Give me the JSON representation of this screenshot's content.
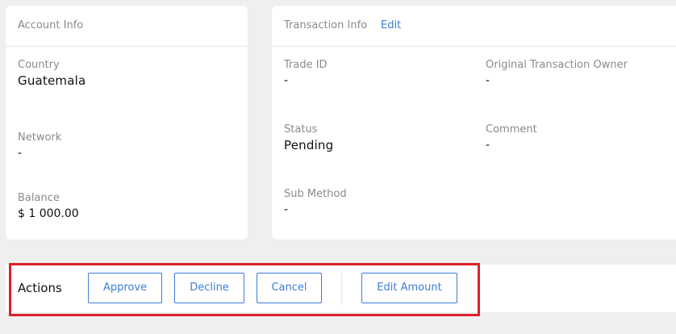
{
  "account_info": {
    "title": "Account Info",
    "fields": [
      {
        "label": "Country",
        "value": "Guatemala"
      },
      {
        "label": "Network",
        "value": "-"
      },
      {
        "label": "Balance",
        "value": "$ 1 000.00"
      }
    ]
  },
  "transaction_info": {
    "title": "Transaction Info",
    "edit_label": "Edit",
    "fields": [
      {
        "label": "Trade ID",
        "value": "-"
      },
      {
        "label": "Original Transaction Owner",
        "value": "-"
      },
      {
        "label": "Status",
        "value": "Pending"
      },
      {
        "label": "Comment",
        "value": "-"
      },
      {
        "label": "Sub Method",
        "value": "-"
      }
    ]
  },
  "actions": {
    "label": "Actions",
    "approve_label": "Approve",
    "decline_label": "Decline",
    "cancel_label": "Cancel",
    "edit_amount_label": "Edit Amount"
  },
  "colors": {
    "accent": "#3b7dd8",
    "highlight": "#e0202a",
    "background": "#efefef"
  }
}
